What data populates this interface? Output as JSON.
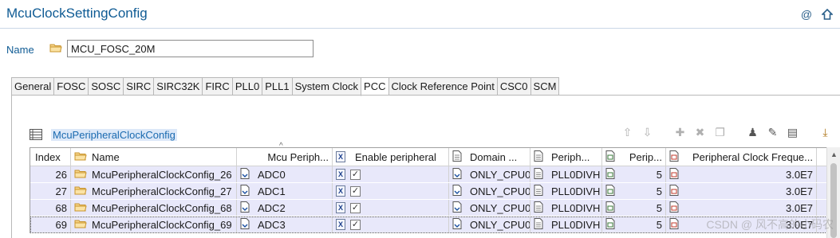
{
  "header": {
    "title": "McuClockSettingConfig",
    "icons": [
      "at-icon",
      "home-up-icon"
    ]
  },
  "name_field": {
    "label": "Name",
    "value": "MCU_FOSC_20M"
  },
  "tabs": [
    {
      "label": "General"
    },
    {
      "label": "FOSC"
    },
    {
      "label": "SOSC"
    },
    {
      "label": "SIRC"
    },
    {
      "label": "SIRC32K"
    },
    {
      "label": "FIRC"
    },
    {
      "label": "PLL0"
    },
    {
      "label": "PLL1"
    },
    {
      "label": "System Clock"
    },
    {
      "label": "PCC",
      "active": true
    },
    {
      "label": "Clock Reference Point"
    },
    {
      "label": "CSC0"
    },
    {
      "label": "SCM"
    }
  ],
  "section": {
    "title": "McuPeripheralClockConfig"
  },
  "table": {
    "columns": [
      "Index",
      "Name",
      "Mcu Periph...",
      "Enable peripheral",
      "Domain ...",
      "Periph...",
      "Perip...",
      "Peripheral Clock Freque..."
    ],
    "rows": [
      {
        "index": "26",
        "name": "McuPeripheralClockConfig_26",
        "mcu": "ADC0",
        "enabled": true,
        "domain": "ONLY_CPU0",
        "periph": "PLL0DIVH",
        "perip": "5",
        "freq": "3.0E7"
      },
      {
        "index": "27",
        "name": "McuPeripheralClockConfig_27",
        "mcu": "ADC1",
        "enabled": true,
        "domain": "ONLY_CPU0",
        "periph": "PLL0DIVH",
        "perip": "5",
        "freq": "3.0E7"
      },
      {
        "index": "68",
        "name": "McuPeripheralClockConfig_68",
        "mcu": "ADC2",
        "enabled": true,
        "domain": "ONLY_CPU0",
        "periph": "PLL0DIVH",
        "perip": "5",
        "freq": "3.0E7"
      },
      {
        "index": "69",
        "name": "McuPeripheralClockConfig_69",
        "mcu": "ADC3",
        "enabled": true,
        "domain": "ONLY_CPU0",
        "periph": "PLL0DIVH",
        "perip": "5",
        "freq": "3.0E7"
      }
    ]
  },
  "toolbar_icons": [
    "move-up-icon",
    "move-down-icon",
    "add-icon",
    "delete-icon",
    "copy-icon",
    "user-config-icon",
    "edit-icon",
    "table-edit-icon",
    "import-icon"
  ],
  "watermark": "CSDN @ 风不高的小码农",
  "colors": {
    "title": "#0f5b94",
    "row_bg": "#e8e8fa",
    "section_highlight": "#dce8f8"
  }
}
